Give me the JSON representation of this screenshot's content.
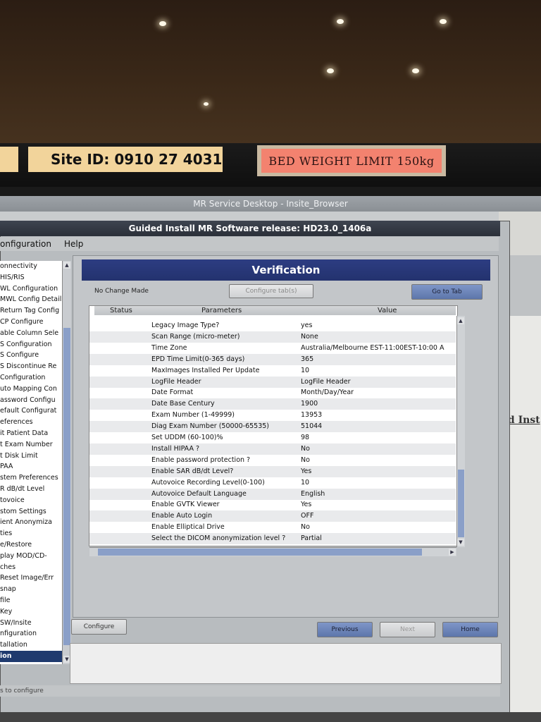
{
  "site_label": "Site ID: 0910 27 4031",
  "bed_label": "BED WEIGHT LIMIT 150kg",
  "browser_title": "MR Service Desktop - Insite_Browser",
  "window_title": "Guided Install  MR Software release: HD23.0_1406a",
  "menu": {
    "configuration": "onfiguration",
    "help": "Help"
  },
  "tree_items": [
    "onnectivity",
    "HIS/RIS",
    "WL Configuration",
    "MWL Config Detail",
    "Return Tag Config",
    "CP Configure",
    "able Column Sele",
    "S Configuration",
    "S Configure",
    "S Discontinue Re",
    "Configuration",
    "uto Mapping Con",
    "assword Configu",
    "efault Configurat",
    "eferences",
    "it Patient Data",
    "t Exam Number",
    "t Disk Limit",
    "PAA",
    "stem Preferences",
    "R dB/dt Level",
    "tovoice",
    "stom Settings",
    "ient Anonymiza",
    "ties",
    "e/Restore",
    "play MOD/CD-",
    "ches",
    "Reset Image/Err",
    "snap",
    "file",
    "Key",
    "SW/Insite",
    "nfiguration",
    "tallation",
    "ion"
  ],
  "verification": {
    "title": "Verification",
    "status_text": "No Change Made",
    "configure_tabs_label": "Configure tab(s)",
    "goto_tab_label": "Go to Tab",
    "columns": {
      "status": "Status",
      "parameters": "Parameters",
      "value": "Value"
    },
    "rows": [
      {
        "param": "Legacy Image Type?",
        "value": "yes"
      },
      {
        "param": "Scan Range (micro-meter)",
        "value": "None"
      },
      {
        "param": "Time Zone",
        "value": "Australia/Melbourne EST-11:00EST-10:00 A"
      },
      {
        "param": "EPD Time Limit(0-365 days)",
        "value": "365"
      },
      {
        "param": "MaxImages Installed Per Update",
        "value": "10"
      },
      {
        "param": "LogFile Header",
        "value": "LogFile Header"
      },
      {
        "param": "Date Format",
        "value": "Month/Day/Year"
      },
      {
        "param": "Date Base Century",
        "value": "1900"
      },
      {
        "param": "Exam Number (1-49999)",
        "value": "13953"
      },
      {
        "param": "Diag Exam Number (50000-65535)",
        "value": "51044"
      },
      {
        "param": "Set UDDM (60-100)%",
        "value": "98"
      },
      {
        "param": "Install HIPAA ?",
        "value": "No"
      },
      {
        "param": "Enable password protection ?",
        "value": "No"
      },
      {
        "param": "Enable SAR dB/dt Level?",
        "value": "Yes"
      },
      {
        "param": "Autovoice Recording Level(0-100)",
        "value": "10"
      },
      {
        "param": "Autovoice Default Language",
        "value": "English"
      },
      {
        "param": "Enable GVTK Viewer",
        "value": "Yes"
      },
      {
        "param": "Enable Auto Login",
        "value": "OFF"
      },
      {
        "param": "Enable Elliptical Drive",
        "value": "No"
      },
      {
        "param": "Select the DICOM anonymization level ?",
        "value": "Partial"
      }
    ]
  },
  "buttons": {
    "configure": "Configure",
    "previous": "Previous",
    "next": "Next",
    "home": "Home"
  },
  "right_partial_text": "ed Inst",
  "status_bar_text": "s to configure"
}
